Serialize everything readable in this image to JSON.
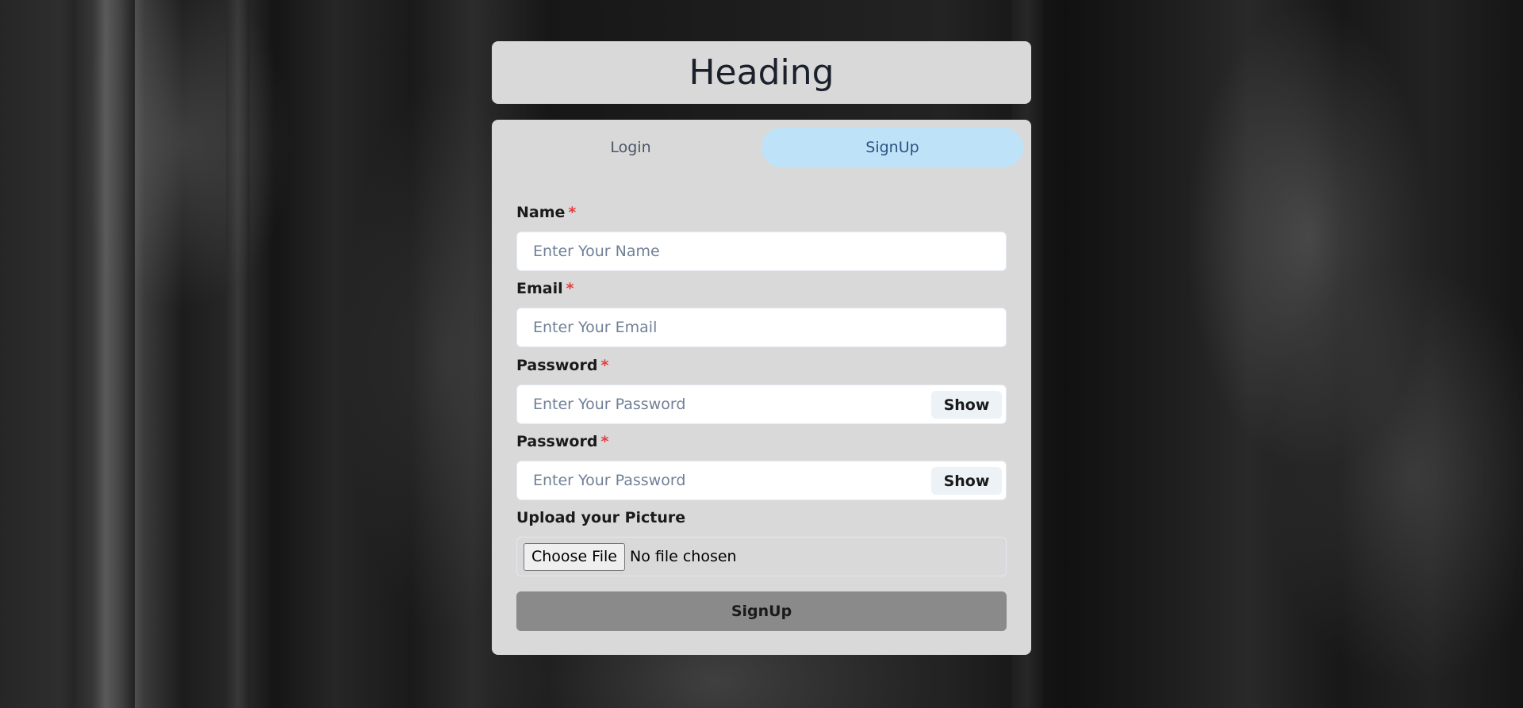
{
  "heading": "Heading",
  "tabs": [
    {
      "label": "Login",
      "active": false
    },
    {
      "label": "SignUp",
      "active": true
    }
  ],
  "required_marker": "*",
  "fields": {
    "name": {
      "label": "Name",
      "placeholder": "Enter Your Name"
    },
    "email": {
      "label": "Email",
      "placeholder": "Enter Your Email"
    },
    "password": {
      "label": "Password",
      "placeholder": "Enter Your Password",
      "toggle": "Show"
    },
    "confirm_password": {
      "label": "Password",
      "placeholder": "Enter Your Password",
      "toggle": "Show"
    }
  },
  "upload": {
    "label": "Upload your Picture",
    "button": "Choose File",
    "status": "No file chosen"
  },
  "submit_label": "SignUp",
  "colors": {
    "card": "#d9d9d9",
    "active_tab": "#bee3f8",
    "submit": "#8a8a8a",
    "required": "#e53e3e"
  }
}
